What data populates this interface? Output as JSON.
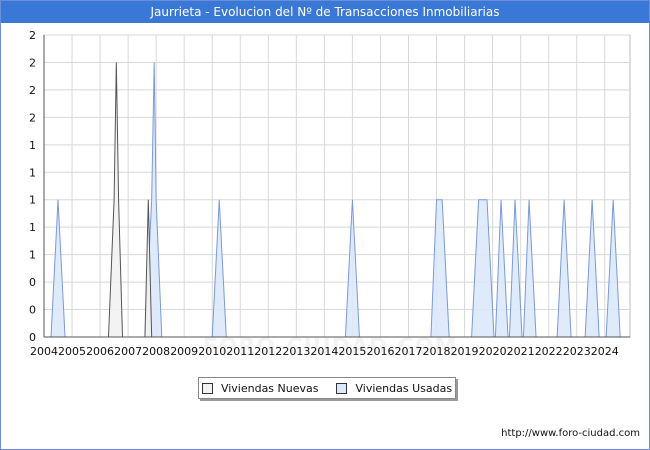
{
  "title": "Jaurrieta - Evolucion del Nº de Transacciones Inmobiliarias",
  "footer": "http://www.foro-ciudad.com",
  "watermark": "FORO-CIUDAD.COM",
  "colors": {
    "title_bg": "#3a78d8",
    "new_fill": "#f2f2f2",
    "new_stroke": "#555555",
    "used_fill": "#dce8fb",
    "used_stroke": "#7a9ad8",
    "grid": "#d8d8d8"
  },
  "chart_data": {
    "type": "area",
    "title": "Jaurrieta - Evolucion del Nº de Transacciones Inmobiliarias",
    "xlabel": "",
    "ylabel": "",
    "x_range": [
      2004.0,
      2024.9
    ],
    "ylim": [
      0,
      2.2
    ],
    "y_ticks": [
      0,
      0.2,
      0.4,
      0.6,
      0.8,
      1.0,
      1.2,
      1.4,
      1.6,
      1.8,
      2.0,
      2.2
    ],
    "y_tick_labels": [
      "0",
      "0",
      "0",
      "1",
      "1",
      "1",
      "1",
      "1",
      "2",
      "2",
      "2",
      "2"
    ],
    "x_tick_labels": [
      "2004",
      "2005",
      "2006",
      "2007",
      "2008",
      "2009",
      "2010",
      "2011",
      "2012",
      "2013",
      "2014",
      "2015",
      "2016",
      "2017",
      "2018",
      "2019",
      "2020",
      "2021",
      "2022",
      "2023",
      "2024"
    ],
    "grid": true,
    "legend_position": "bottom",
    "series": [
      {
        "name": "Viviendas Nuevas",
        "points": [
          [
            2006.3,
            0
          ],
          [
            2006.5,
            1
          ],
          [
            2006.58,
            2
          ],
          [
            2006.66,
            1
          ],
          [
            2006.8,
            0
          ],
          [
            2007.6,
            0
          ],
          [
            2007.72,
            1
          ],
          [
            2007.84,
            0
          ]
        ]
      },
      {
        "name": "Viviendas Usadas",
        "points": [
          [
            2004.25,
            0
          ],
          [
            2004.5,
            1
          ],
          [
            2004.75,
            0
          ],
          [
            2007.6,
            0
          ],
          [
            2007.84,
            1
          ],
          [
            2007.93,
            2
          ],
          [
            2008.0,
            1
          ],
          [
            2008.2,
            0
          ],
          [
            2010.0,
            0
          ],
          [
            2010.25,
            1
          ],
          [
            2010.5,
            0
          ],
          [
            2014.75,
            0
          ],
          [
            2015.0,
            1
          ],
          [
            2015.25,
            0
          ],
          [
            2017.8,
            0
          ],
          [
            2018.0,
            1
          ],
          [
            2018.2,
            1
          ],
          [
            2018.45,
            0
          ],
          [
            2019.25,
            0
          ],
          [
            2019.5,
            1
          ],
          [
            2019.8,
            1
          ],
          [
            2020.05,
            0
          ],
          [
            2020.1,
            0
          ],
          [
            2020.3,
            1
          ],
          [
            2020.55,
            0
          ],
          [
            2020.6,
            0
          ],
          [
            2020.8,
            1
          ],
          [
            2021.05,
            0
          ],
          [
            2021.1,
            0
          ],
          [
            2021.3,
            1
          ],
          [
            2021.55,
            0
          ],
          [
            2022.3,
            0
          ],
          [
            2022.55,
            1
          ],
          [
            2022.8,
            0
          ],
          [
            2023.3,
            0
          ],
          [
            2023.55,
            1
          ],
          [
            2023.8,
            0
          ],
          [
            2024.05,
            0
          ],
          [
            2024.3,
            1
          ],
          [
            2024.55,
            0
          ]
        ]
      }
    ]
  },
  "legend": {
    "new_label": "Viviendas Nuevas",
    "used_label": "Viviendas Usadas"
  }
}
